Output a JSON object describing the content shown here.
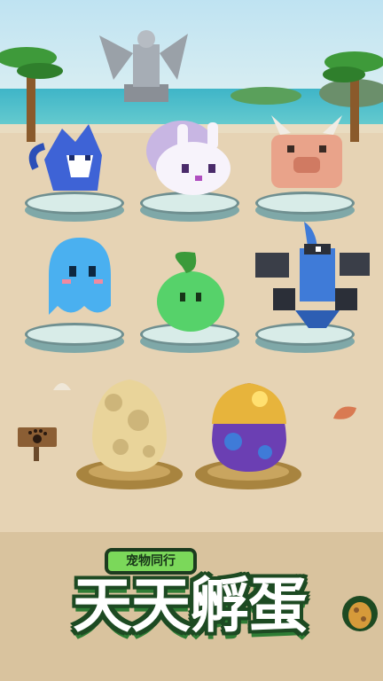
{
  "banner": {
    "subtitle": "宠物同行",
    "title": "天天孵蛋"
  },
  "pets": [
    {
      "name": "blue-wolf",
      "color": "#3e63d6"
    },
    {
      "name": "white-bunny",
      "color": "#f5f0fa"
    },
    {
      "name": "horned-pig",
      "color": "#e9a38a"
    },
    {
      "name": "blue-ghost",
      "color": "#4ab0f0"
    },
    {
      "name": "green-slime",
      "color": "#56d26a"
    },
    {
      "name": "stone-golem",
      "color": "#3f7bd8"
    }
  ],
  "eggs": [
    {
      "name": "sand-egg",
      "color": "#e9d49a"
    },
    {
      "name": "purple-gold-egg",
      "color": "#6b3fb3"
    }
  ],
  "colors": {
    "sand": "#e6d3b4",
    "sea": "#3fb5c8",
    "title_outline": "#1d4a22",
    "badge": "#7bd85a"
  }
}
